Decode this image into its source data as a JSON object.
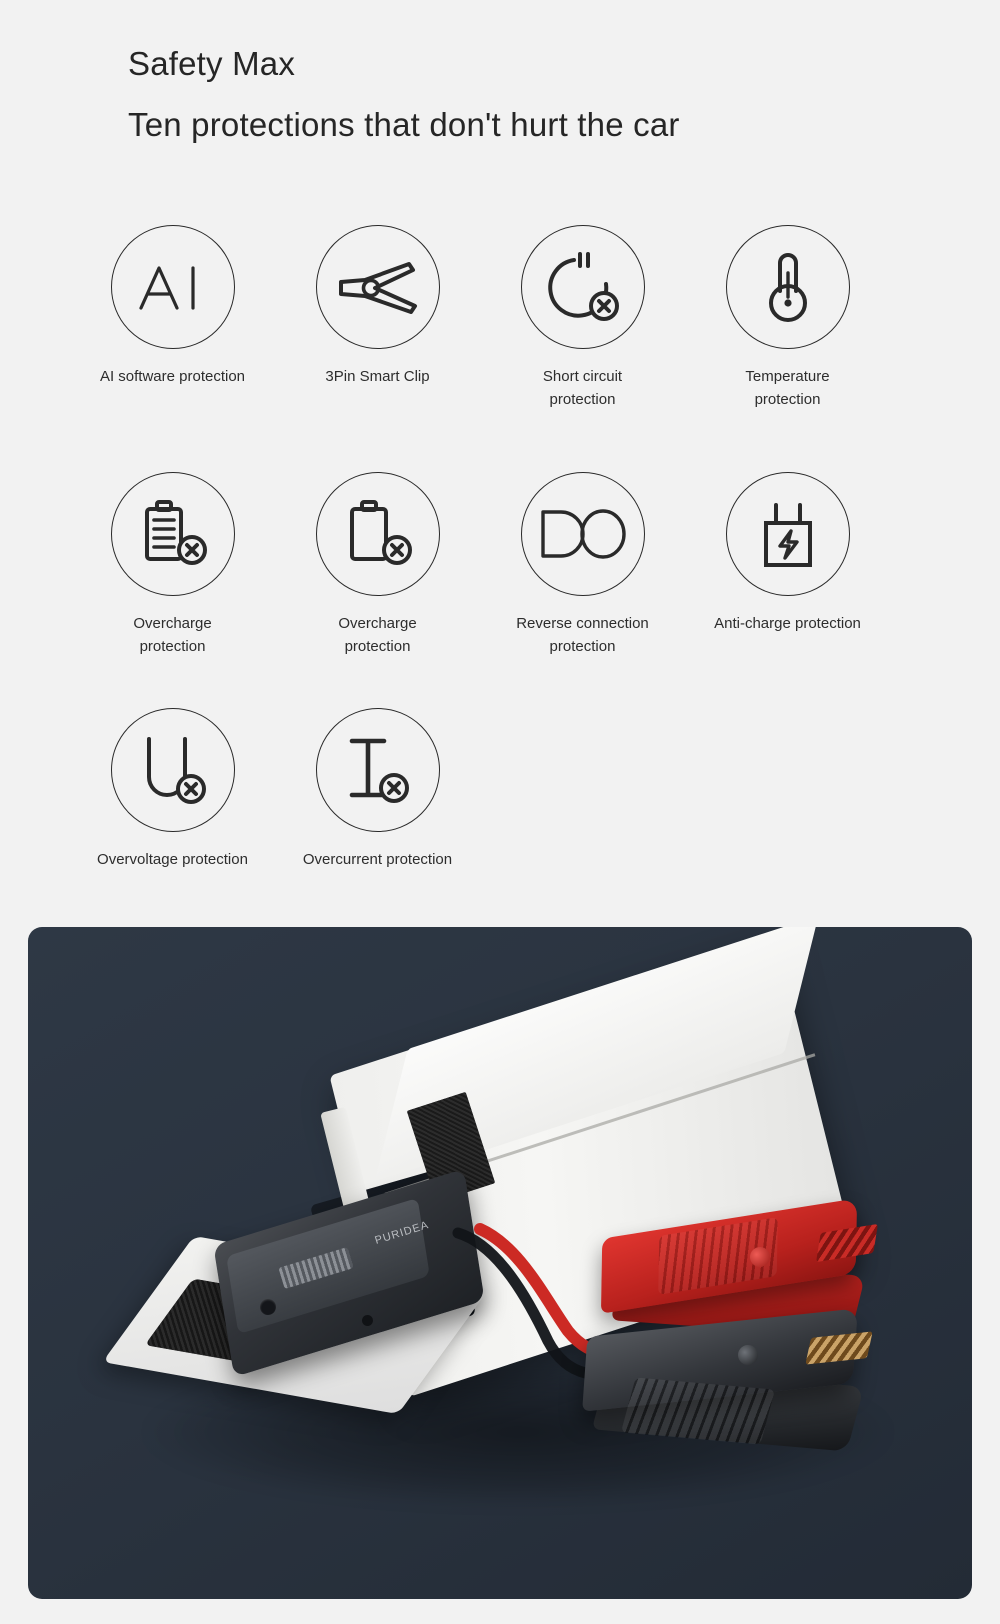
{
  "headings": {
    "title": "Safety Max",
    "subtitle": "Ten protections that don't hurt the car"
  },
  "colors": {
    "page_background": "#f2f2f2",
    "text": "#262626",
    "icon_stroke": "#2a2a2a",
    "photo_panel_background": "#2b3542",
    "clamp_red": "#c22b25",
    "clamp_black": "#33363b"
  },
  "protections": [
    {
      "icon": "ai-text-icon",
      "glyph": "AI",
      "label": "AI software protection"
    },
    {
      "icon": "battery-clip-icon",
      "glyph": "",
      "label": "3Pin Smart Clip"
    },
    {
      "icon": "short-circuit-icon",
      "glyph": "",
      "label": "Short circuit\nprotection"
    },
    {
      "icon": "thermometer-icon",
      "glyph": "",
      "label": "Temperature\nprotection"
    },
    {
      "icon": "battery-full-blocked-icon",
      "glyph": "",
      "label": "Overcharge\nprotection"
    },
    {
      "icon": "battery-empty-blocked-icon",
      "glyph": "",
      "label": "Overcharge\nprotection"
    },
    {
      "icon": "do-text-icon",
      "glyph": "DO",
      "label": "Reverse connection\nprotection"
    },
    {
      "icon": "plug-bolt-icon",
      "glyph": "",
      "label": "Anti-charge protection"
    },
    {
      "icon": "voltage-u-blocked-icon",
      "glyph": "",
      "label": "Overvoltage protection"
    },
    {
      "icon": "current-i-blocked-icon",
      "glyph": "",
      "label": "Overcurrent protection"
    }
  ],
  "photo": {
    "alt": "Jump starter with white fireproof storage bag, red and black battery clamps on dark navy background",
    "device_brand": "PURIDEA",
    "elements": [
      "white-fireproof-bag",
      "velcro-patch",
      "black-jump-starter",
      "red-clamp",
      "black-clamp",
      "red-cable",
      "black-cable"
    ]
  }
}
